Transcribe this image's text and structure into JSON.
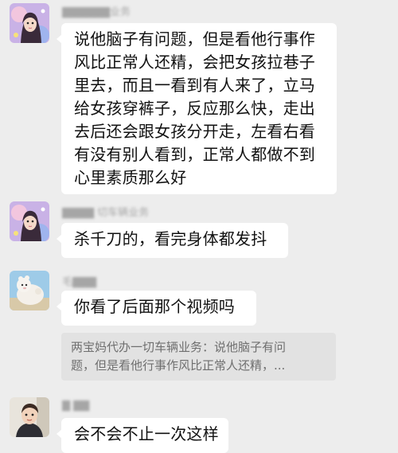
{
  "messages": [
    {
      "sender": "▇▇▇▇▇▇业务",
      "text": "说他脑子有问题，但是看他行事作\n风比正常人还精，会把女孩拉巷子\n里去，而且一看到有人来了，立马\n给女孩穿裤子，反应那么快，走出\n去后还会跟女孩分开走，左看右看\n有没有别人看到，正常人都做不到\n心里素质那么好"
    },
    {
      "sender": "▇▇▇▇ 切车辆业务",
      "text": "杀千刀的，看完身体都发抖"
    },
    {
      "sender": "毛▇▇▇",
      "text": "你看了后面那个视频吗",
      "quote": "两宝妈代办一切车辆业务：说他脑子有问\n题，但是看他行事作风比正常人还精，..."
    },
    {
      "sender": "▇ ▇▇",
      "text": "会不会不止一次这样"
    }
  ],
  "colors": {
    "background": "#ededed",
    "bubble": "#ffffff",
    "quote_bg": "#e2e2e2"
  }
}
